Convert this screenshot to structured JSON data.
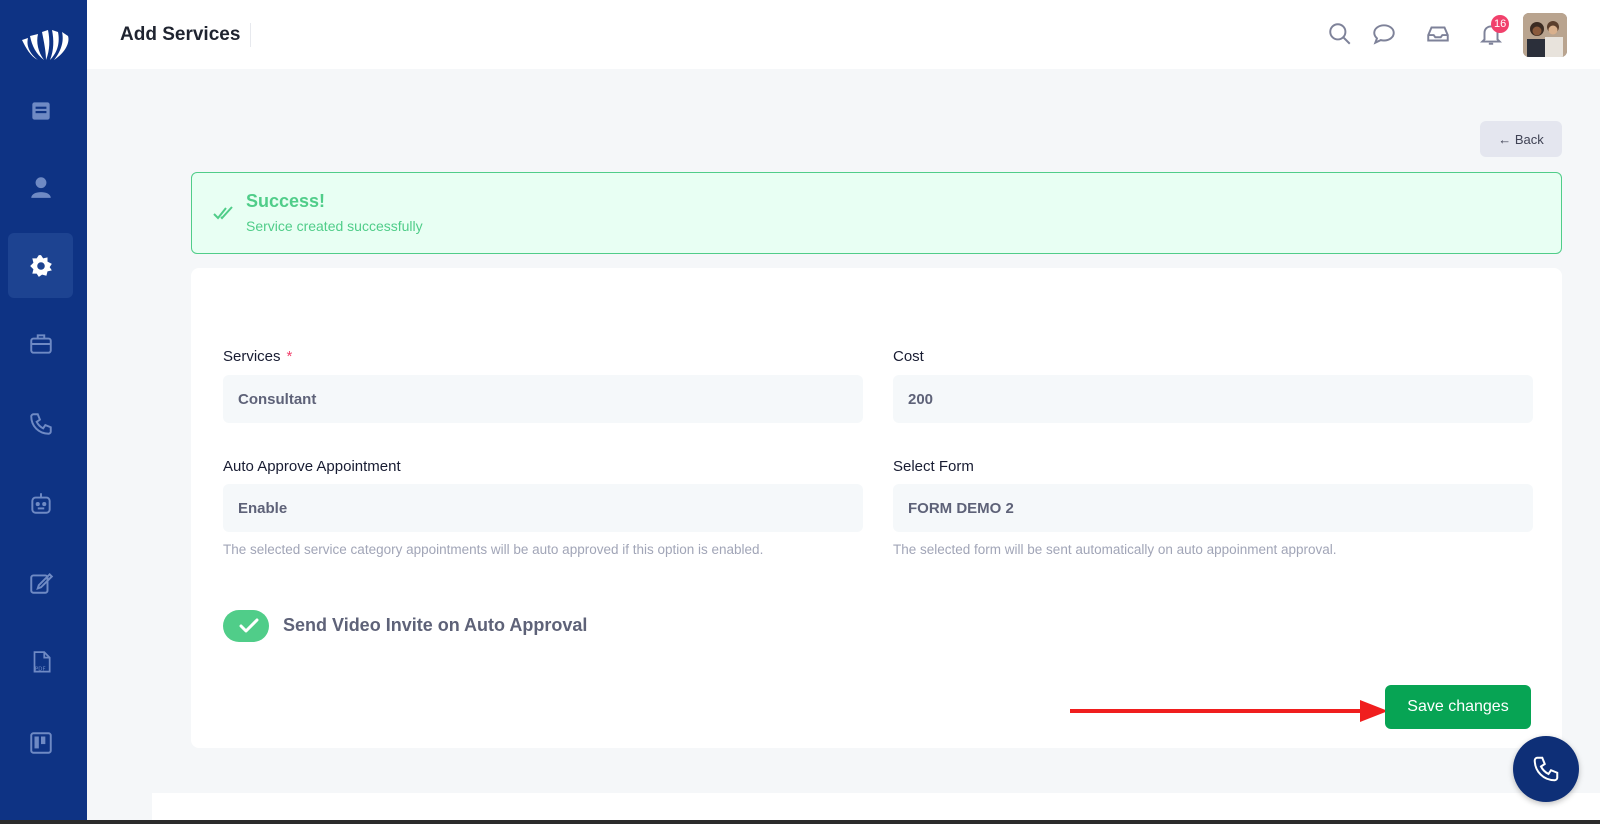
{
  "header": {
    "title": "Add Services",
    "notification_count": "16"
  },
  "back_button": {
    "label": "← Back"
  },
  "alert": {
    "title": "Success!",
    "message": "Service created successfully"
  },
  "form": {
    "services": {
      "label": "Services",
      "required_mark": "*",
      "value": "Consultant"
    },
    "cost": {
      "label": "Cost",
      "value": "200"
    },
    "auto_approve": {
      "label": "Auto Approve Appointment",
      "value": "Enable",
      "hint": "The selected service category appointments will be auto approved if this option is enabled."
    },
    "select_form": {
      "label": "Select Form",
      "value": "FORM DEMO 2",
      "hint": "The selected form will be sent automatically on auto appoinment approval."
    },
    "video_invite": {
      "label": "Send Video Invite on Auto Approval",
      "enabled": true
    },
    "save_label": "Save changes"
  },
  "colors": {
    "sidebar": "#0e3384",
    "success": "#50cd89",
    "save_button": "#07a454",
    "annotation_arrow": "#f01e1e"
  },
  "sidebar_icons": [
    "calendar-icon",
    "user-icon",
    "gear-icon",
    "briefcase-icon",
    "phone-icon",
    "robot-icon",
    "edit-icon",
    "pdf-icon",
    "board-icon"
  ]
}
